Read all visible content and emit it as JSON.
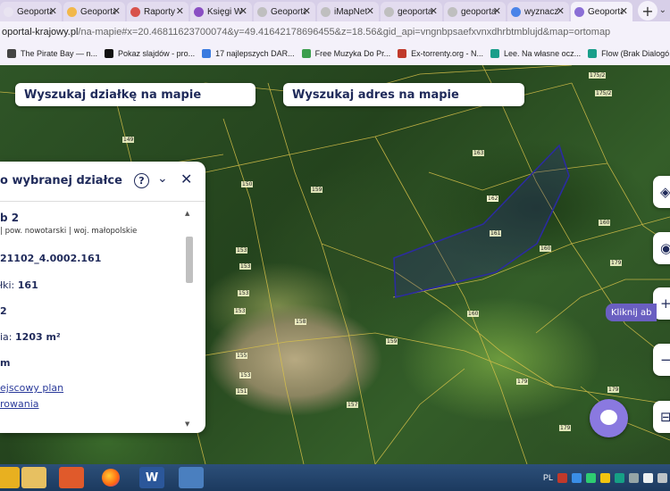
{
  "browser": {
    "tabs": [
      {
        "label": "Geoportal",
        "color": "#e9e4f1",
        "active": false
      },
      {
        "label": "Geoportal",
        "color": "#f2b84b",
        "active": false
      },
      {
        "label": "Raporty",
        "color": "#d8524b",
        "active": false
      },
      {
        "label": "Księgi W",
        "color": "#8a4fc3",
        "active": false
      },
      {
        "label": "Geoportal",
        "color": "#bfbfbf",
        "active": false
      },
      {
        "label": "iMapNet",
        "color": "#bfbfbf",
        "active": false
      },
      {
        "label": "geoportal",
        "color": "#bfbfbf",
        "active": false
      },
      {
        "label": "geoportal",
        "color": "#bfbfbf",
        "active": false
      },
      {
        "label": "wyznacz",
        "color": "#4a84e8",
        "active": false
      },
      {
        "label": "Geoportal",
        "color": "#8b6fd6",
        "active": true
      }
    ],
    "new_tab": "+",
    "tab_close": "✕",
    "url_main": "oportal-krajowy.pl",
    "url_rest": "/na-mapie#x=20.46811623700074&y=49.41642178696455&z=18.56&gid_api=vngnbpsaefxvnxdhrbtmblujd&map=ortomap",
    "bookmarks": [
      {
        "label": "The Pirate Bay — n...",
        "color": "#444444"
      },
      {
        "label": "Pokaz slajdów - pro...",
        "color": "#111111"
      },
      {
        "label": "17 najlepszych DAR...",
        "color": "#3a7be0"
      },
      {
        "label": "Free Muzyka Do Pr...",
        "color": "#3c9e4e"
      },
      {
        "label": "Ex-torrenty.org - N...",
        "color": "#c0392b"
      },
      {
        "label": "Lee. Na własne ocz...",
        "color": "#1a9e8a"
      },
      {
        "label": "Flow (Brak Dialogó...",
        "color": "#1a9e8a"
      }
    ]
  },
  "map": {
    "search_parcel": "Wyszukaj działkę na mapie",
    "search_address": "Wyszukaj adres na mapie",
    "parcel_labels": [
      "149",
      "150",
      "159",
      "153",
      "153",
      "153",
      "153",
      "158",
      "159",
      "157",
      "155",
      "151",
      "162",
      "163",
      "161",
      "160",
      "160",
      "162",
      "160",
      "179",
      "179",
      "179",
      "175/2",
      "175/2",
      "179",
      "153"
    ],
    "kliknij": "Kliknij ab",
    "tool_icons": [
      "layers-icon",
      "eye-icon",
      "zoom-in-icon",
      "zoom-out-icon",
      "print-icon"
    ]
  },
  "panel": {
    "title": "o wybranej działce",
    "help": "?",
    "name": "b 2",
    "location": "| pow. nowotarski | woj. małopolskie",
    "parcel_id": "21102_4.0002.161",
    "parcel_number_prefix": "łki:",
    "parcel_number": "161",
    "obreb": "2",
    "area_prefix": "ia:",
    "area": "1203 m²",
    "length": "m",
    "link1": "ejscowy plan",
    "link2": "rowania"
  },
  "taskbar": {
    "lang": "PL"
  }
}
